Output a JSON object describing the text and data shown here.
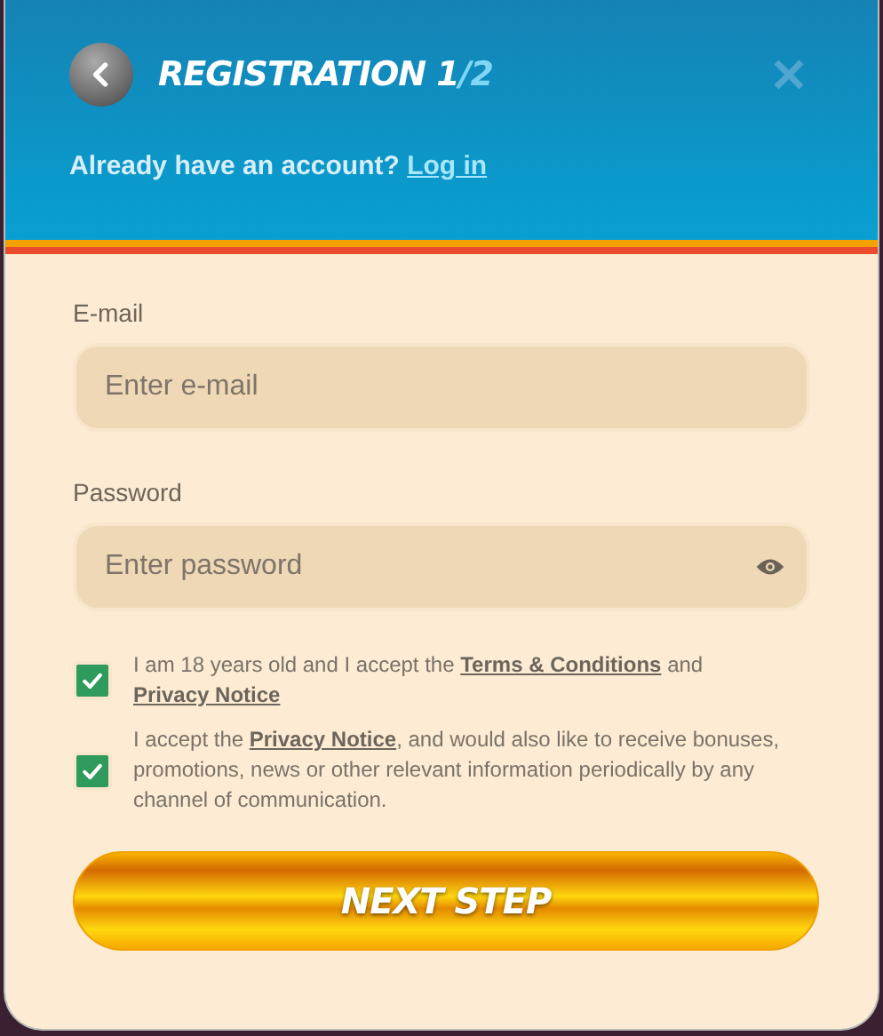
{
  "header": {
    "title": "REGISTRATION 1",
    "step_suffix": "/2",
    "login_prompt": "Already have an account?",
    "login_link": "Log in"
  },
  "fields": [
    {
      "label": "E-mail",
      "placeholder": "Enter e-mail",
      "kind": "text"
    },
    {
      "label": "Password",
      "placeholder": "Enter password",
      "kind": "password"
    }
  ],
  "consents": [
    {
      "checked": true,
      "parts": [
        {
          "kind": "text",
          "text": "I am 18 years old and I accept the "
        },
        {
          "kind": "link",
          "text": "Terms & Conditions"
        },
        {
          "kind": "text",
          "text": " and "
        },
        {
          "kind": "link",
          "text": "Privacy Notice"
        }
      ]
    },
    {
      "checked": true,
      "parts": [
        {
          "kind": "text",
          "text": "I accept the "
        },
        {
          "kind": "link",
          "text": "Privacy Notice"
        },
        {
          "kind": "text",
          "text": ", and would also like to receive bonuses, promotions, news or other relevant information periodically by any channel of communication."
        }
      ]
    }
  ],
  "submit": "NEXT STEP"
}
